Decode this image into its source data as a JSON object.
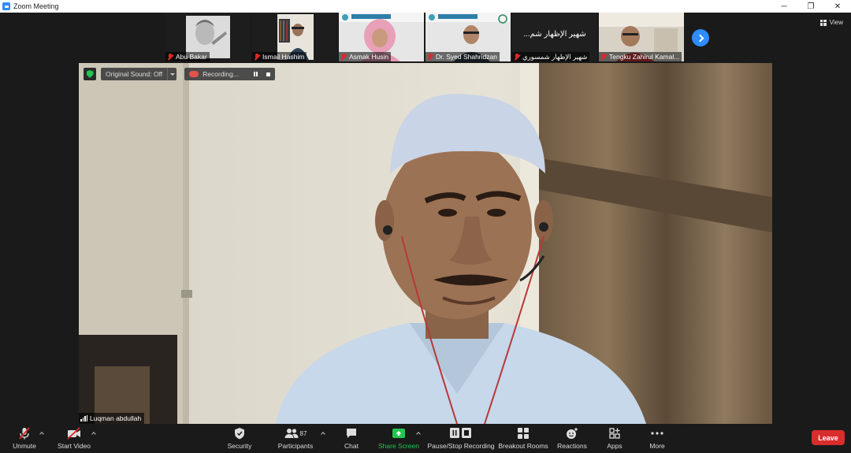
{
  "window": {
    "title": "Zoom Meeting",
    "controls": {
      "minimize": "─",
      "restore": "❐",
      "close": "✕"
    }
  },
  "gallery": {
    "view_label": "View",
    "participants": [
      {
        "name": "Abu Bakar",
        "muted": true
      },
      {
        "name": "Ismail Hashim",
        "muted": true
      },
      {
        "name": "Asmak Husin",
        "muted": true
      },
      {
        "name": "Dr. Syed Shahridzan",
        "muted": true
      },
      {
        "name": "شهير الإظهار شمسوري",
        "muted": true,
        "display_text": "شهير الإظهار شم..."
      },
      {
        "name": "Tengku Zahirul Kamal...",
        "muted": true
      }
    ]
  },
  "overlay": {
    "original_sound": "Original Sound: Off",
    "recording": "Recording..."
  },
  "active_speaker": {
    "name": "Luqman abdullah"
  },
  "toolbar": {
    "unmute": "Unmute",
    "start_video": "Start Video",
    "security": "Security",
    "participants": "Participants",
    "participant_count": "87",
    "chat": "Chat",
    "share_screen": "Share Screen",
    "recording": "Pause/Stop Recording",
    "breakout": "Breakout Rooms",
    "reactions": "Reactions",
    "apps": "Apps",
    "more": "More",
    "leave": "Leave"
  },
  "colors": {
    "accent": "#2d8cff",
    "muted_red": "#e02828",
    "share_green": "#23c451",
    "leave_red": "#d92c2c"
  }
}
